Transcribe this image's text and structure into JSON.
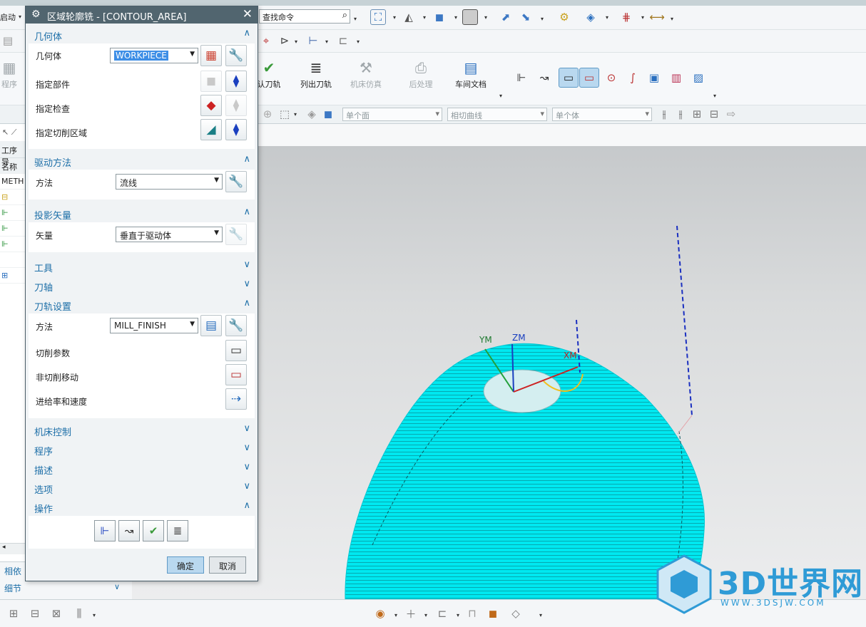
{
  "toolbar": {
    "start_label": "启动",
    "search_placeholder": "查找命令",
    "program_label": "程序",
    "big_buttons": [
      "认刀轨",
      "列出刀轨",
      "机床仿真",
      "后处理",
      "车间文档"
    ],
    "filters": [
      "单个面",
      "相切曲线",
      "单个体"
    ]
  },
  "navigator": {
    "header": "工序导",
    "col_name": "名称",
    "row_method": "METH",
    "bottom_1": "相依",
    "bottom_2": "细节"
  },
  "dialog": {
    "title": "区域轮廓铣 - [CONTOUR_AREA]",
    "sections": {
      "geometry": {
        "title": "几何体",
        "label_geom": "几何体",
        "geom_value": "WORKPIECE",
        "label_part": "指定部件",
        "label_check": "指定检查",
        "label_cut_area": "指定切削区域"
      },
      "drive": {
        "title": "驱动方法",
        "label": "方法",
        "value": "流线"
      },
      "projection": {
        "title": "投影矢量",
        "label": "矢量",
        "value": "垂直于驱动体"
      },
      "tool": {
        "title": "工具"
      },
      "axis": {
        "title": "刀轴"
      },
      "path": {
        "title": "刀轨设置",
        "label_method": "方法",
        "method_value": "MILL_FINISH",
        "label_cut_params": "切削参数",
        "label_noncut": "非切削移动",
        "label_feeds": "进给率和速度"
      },
      "machine": {
        "title": "机床控制"
      },
      "program": {
        "title": "程序"
      },
      "description": {
        "title": "描述"
      },
      "options": {
        "title": "选项"
      },
      "actions": {
        "title": "操作"
      }
    },
    "ok": "确定",
    "cancel": "取消"
  },
  "viewport": {
    "axis_labels": {
      "ym": "YM",
      "zm": "ZM",
      "xm": "XM"
    },
    "colors": {
      "toolpath": "#00e8f0",
      "background_top": "#c6c9cb",
      "background_bottom": "#ecedee"
    }
  },
  "watermark": {
    "brand": "3D世界网",
    "url": "WWW.3DSJW.COM"
  }
}
